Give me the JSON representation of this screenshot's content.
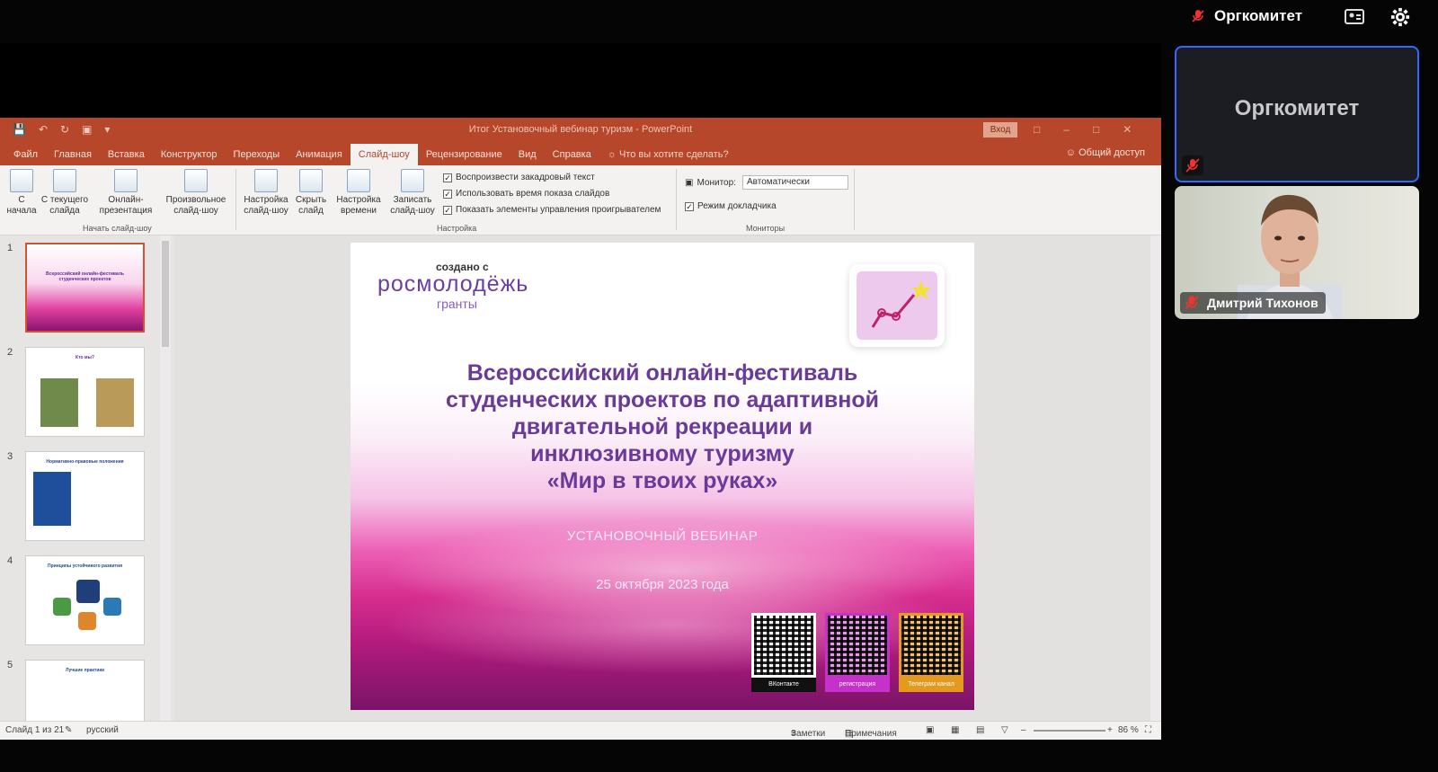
{
  "meeting": {
    "active_user": "Оргкомитет",
    "participants": [
      {
        "name": "Оргкомитет",
        "muted": true
      },
      {
        "name": "Дмитрий Тихонов",
        "muted": true
      }
    ]
  },
  "ppt": {
    "window_title": "Итог Установочный вебинар туризм - PowerPoint",
    "signin": "Вход",
    "tabs": [
      "Файл",
      "Главная",
      "Вставка",
      "Конструктор",
      "Переходы",
      "Анимация",
      "Слайд-шоу",
      "Рецензирование",
      "Вид",
      "Справка"
    ],
    "active_tab": "Слайд-шоу",
    "tell_me": "Что вы хотите сделать?",
    "share": "Общий доступ",
    "ribbon": {
      "start_group": "Начать слайд-шоу",
      "btn_from_start": "С начала",
      "btn_from_current": "С текущего слайда",
      "btn_online": "Онлайн-презентация",
      "btn_custom": "Произвольное слайд-шоу",
      "btn_setup": "Настройка слайд-шоу",
      "btn_hide": "Скрыть слайд",
      "btn_timing": "Настройка времени",
      "btn_record": "Записать слайд-шоу",
      "setup_group": "Настройка",
      "chk_narration": "Воспроизвести закадровый текст",
      "chk_timings": "Использовать время показа слайдов",
      "chk_controls": "Показать элементы управления проигрывателем",
      "monitor_label": "Монитор:",
      "monitor_value": "Автоматически",
      "chk_presenter": "Режим докладчика",
      "monitors_group": "Мониторы"
    },
    "slide_numbers": [
      "1",
      "2",
      "3",
      "4",
      "5"
    ],
    "thumb_titles": [
      "Всероссийский онлайн-фестиваль студенческих проектов",
      "Кто мы?",
      "Нормативно-правовые положения",
      "Принципы устойчивого развития",
      "Лучшие практики"
    ],
    "slide": {
      "created_with": "создано с",
      "brand": "росмолодёжь",
      "brand_sub": "гранты",
      "title_lines": [
        "Всероссийский онлайн-фестиваль",
        "студенческих проектов по адаптивной",
        "двигательной рекреации и",
        "инклюзивному туризму",
        "«Мир в твоих руках»"
      ],
      "subtitle": "УСТАНОВОЧНЫЙ ВЕБИНАР",
      "date": "25 октября 2023 года",
      "qr_labels": [
        "ВКонтакте",
        "регистрация",
        "Телеграм канал"
      ]
    },
    "status": {
      "slide_of": "Слайд 1 из 21",
      "language": "русский",
      "notes": "Заметки",
      "comments": "Примечания",
      "zoom": "86 %"
    }
  },
  "colors": {
    "accent": "#b7472a",
    "active_tile_border": "#2f6bff"
  }
}
